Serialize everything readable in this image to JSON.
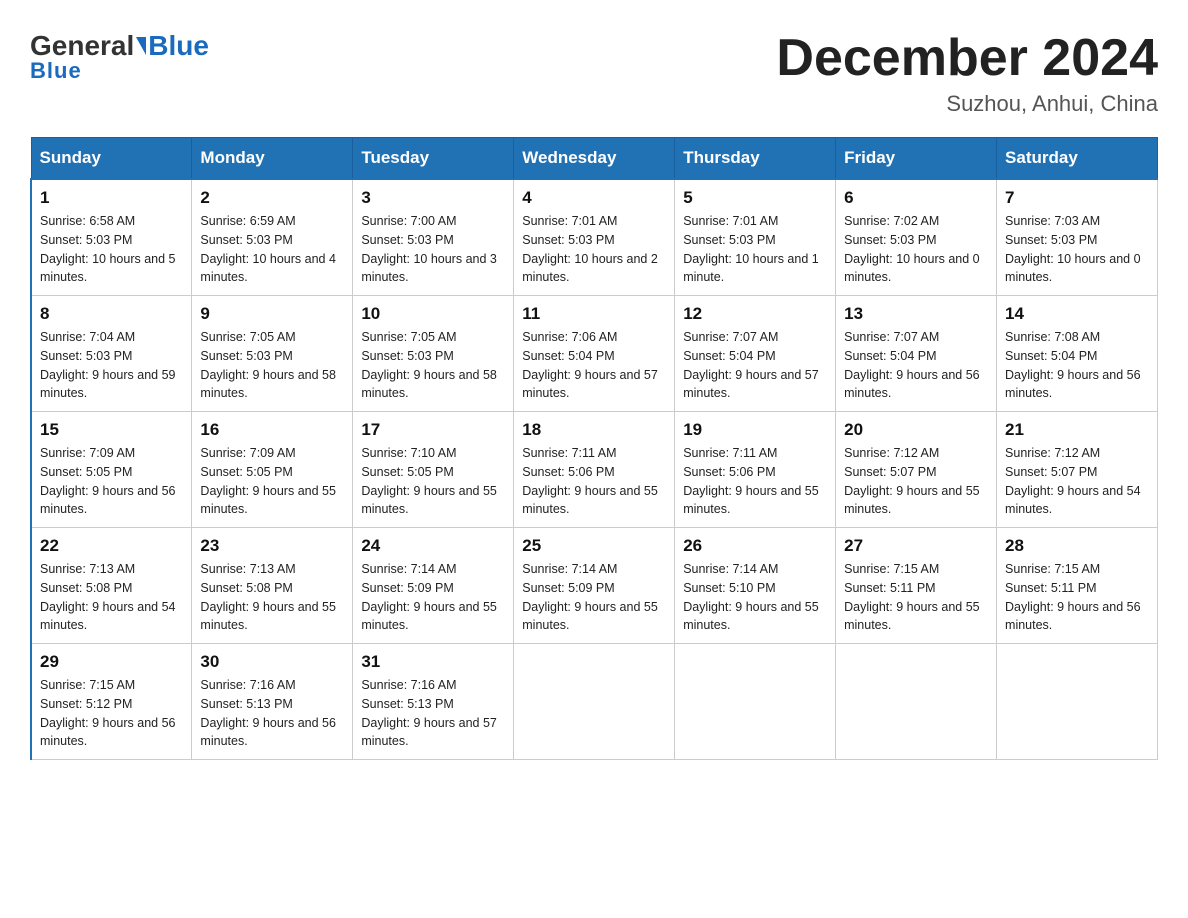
{
  "header": {
    "logo_general": "General",
    "logo_blue": "Blue",
    "month_year": "December 2024",
    "location": "Suzhou, Anhui, China"
  },
  "days_of_week": [
    "Sunday",
    "Monday",
    "Tuesday",
    "Wednesday",
    "Thursday",
    "Friday",
    "Saturday"
  ],
  "weeks": [
    [
      {
        "day": "1",
        "sunrise": "6:58 AM",
        "sunset": "5:03 PM",
        "daylight": "10 hours and 5 minutes."
      },
      {
        "day": "2",
        "sunrise": "6:59 AM",
        "sunset": "5:03 PM",
        "daylight": "10 hours and 4 minutes."
      },
      {
        "day": "3",
        "sunrise": "7:00 AM",
        "sunset": "5:03 PM",
        "daylight": "10 hours and 3 minutes."
      },
      {
        "day": "4",
        "sunrise": "7:01 AM",
        "sunset": "5:03 PM",
        "daylight": "10 hours and 2 minutes."
      },
      {
        "day": "5",
        "sunrise": "7:01 AM",
        "sunset": "5:03 PM",
        "daylight": "10 hours and 1 minute."
      },
      {
        "day": "6",
        "sunrise": "7:02 AM",
        "sunset": "5:03 PM",
        "daylight": "10 hours and 0 minutes."
      },
      {
        "day": "7",
        "sunrise": "7:03 AM",
        "sunset": "5:03 PM",
        "daylight": "10 hours and 0 minutes."
      }
    ],
    [
      {
        "day": "8",
        "sunrise": "7:04 AM",
        "sunset": "5:03 PM",
        "daylight": "9 hours and 59 minutes."
      },
      {
        "day": "9",
        "sunrise": "7:05 AM",
        "sunset": "5:03 PM",
        "daylight": "9 hours and 58 minutes."
      },
      {
        "day": "10",
        "sunrise": "7:05 AM",
        "sunset": "5:03 PM",
        "daylight": "9 hours and 58 minutes."
      },
      {
        "day": "11",
        "sunrise": "7:06 AM",
        "sunset": "5:04 PM",
        "daylight": "9 hours and 57 minutes."
      },
      {
        "day": "12",
        "sunrise": "7:07 AM",
        "sunset": "5:04 PM",
        "daylight": "9 hours and 57 minutes."
      },
      {
        "day": "13",
        "sunrise": "7:07 AM",
        "sunset": "5:04 PM",
        "daylight": "9 hours and 56 minutes."
      },
      {
        "day": "14",
        "sunrise": "7:08 AM",
        "sunset": "5:04 PM",
        "daylight": "9 hours and 56 minutes."
      }
    ],
    [
      {
        "day": "15",
        "sunrise": "7:09 AM",
        "sunset": "5:05 PM",
        "daylight": "9 hours and 56 minutes."
      },
      {
        "day": "16",
        "sunrise": "7:09 AM",
        "sunset": "5:05 PM",
        "daylight": "9 hours and 55 minutes."
      },
      {
        "day": "17",
        "sunrise": "7:10 AM",
        "sunset": "5:05 PM",
        "daylight": "9 hours and 55 minutes."
      },
      {
        "day": "18",
        "sunrise": "7:11 AM",
        "sunset": "5:06 PM",
        "daylight": "9 hours and 55 minutes."
      },
      {
        "day": "19",
        "sunrise": "7:11 AM",
        "sunset": "5:06 PM",
        "daylight": "9 hours and 55 minutes."
      },
      {
        "day": "20",
        "sunrise": "7:12 AM",
        "sunset": "5:07 PM",
        "daylight": "9 hours and 55 minutes."
      },
      {
        "day": "21",
        "sunrise": "7:12 AM",
        "sunset": "5:07 PM",
        "daylight": "9 hours and 54 minutes."
      }
    ],
    [
      {
        "day": "22",
        "sunrise": "7:13 AM",
        "sunset": "5:08 PM",
        "daylight": "9 hours and 54 minutes."
      },
      {
        "day": "23",
        "sunrise": "7:13 AM",
        "sunset": "5:08 PM",
        "daylight": "9 hours and 55 minutes."
      },
      {
        "day": "24",
        "sunrise": "7:14 AM",
        "sunset": "5:09 PM",
        "daylight": "9 hours and 55 minutes."
      },
      {
        "day": "25",
        "sunrise": "7:14 AM",
        "sunset": "5:09 PM",
        "daylight": "9 hours and 55 minutes."
      },
      {
        "day": "26",
        "sunrise": "7:14 AM",
        "sunset": "5:10 PM",
        "daylight": "9 hours and 55 minutes."
      },
      {
        "day": "27",
        "sunrise": "7:15 AM",
        "sunset": "5:11 PM",
        "daylight": "9 hours and 55 minutes."
      },
      {
        "day": "28",
        "sunrise": "7:15 AM",
        "sunset": "5:11 PM",
        "daylight": "9 hours and 56 minutes."
      }
    ],
    [
      {
        "day": "29",
        "sunrise": "7:15 AM",
        "sunset": "5:12 PM",
        "daylight": "9 hours and 56 minutes."
      },
      {
        "day": "30",
        "sunrise": "7:16 AM",
        "sunset": "5:13 PM",
        "daylight": "9 hours and 56 minutes."
      },
      {
        "day": "31",
        "sunrise": "7:16 AM",
        "sunset": "5:13 PM",
        "daylight": "9 hours and 57 minutes."
      },
      null,
      null,
      null,
      null
    ]
  ]
}
